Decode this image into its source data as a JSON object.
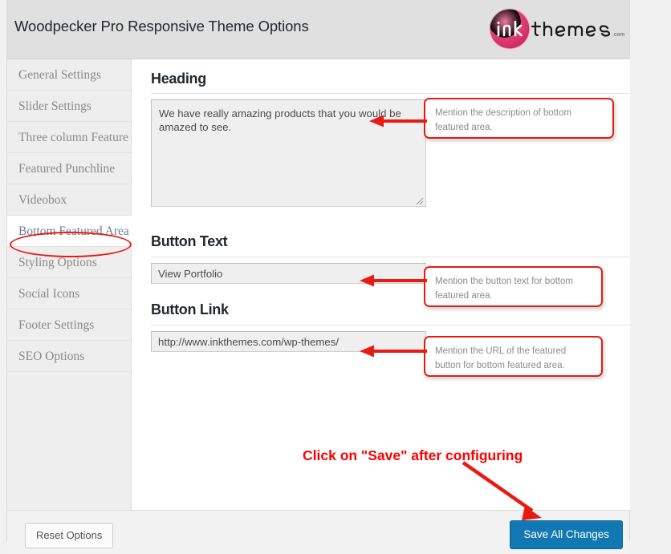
{
  "header": {
    "title": "Woodpecker Pro Responsive Theme Options",
    "logo": {
      "mark": "ink",
      "word": "themes",
      "tld": ".com",
      "color": "#e0417a"
    }
  },
  "sidebar": {
    "items": [
      {
        "label": "General Settings",
        "active": false
      },
      {
        "label": "Slider Settings",
        "active": false
      },
      {
        "label": "Three column Feature",
        "active": false
      },
      {
        "label": "Featured Punchline",
        "active": false
      },
      {
        "label": "Videobox",
        "active": false
      },
      {
        "label": "Bottom Featured Area",
        "active": true
      },
      {
        "label": "Styling Options",
        "active": false
      },
      {
        "label": "Social Icons",
        "active": false
      },
      {
        "label": "Footer Settings",
        "active": false
      },
      {
        "label": "SEO Options",
        "active": false
      }
    ]
  },
  "main": {
    "heading_section": {
      "title": "Heading",
      "value": "We have really amazing products that you would be amazed to see."
    },
    "button_text_section": {
      "title": "Button Text",
      "value": "View Portfolio"
    },
    "button_link_section": {
      "title": "Button Link",
      "value": "http://www.inkthemes.com/wp-themes/"
    }
  },
  "footer": {
    "reset_label": "Reset Options",
    "save_label": "Save All Changes"
  },
  "annotations": {
    "accent_color": "#e81b12",
    "heading_note": "Mention the description of bottom featured area.",
    "button_text_note": "Mention the button text for bottom featured area.",
    "button_link_note": "Mention the URL of the featured button for bottom featured area.",
    "save_note": "Click on \"Save\" after configuring"
  }
}
